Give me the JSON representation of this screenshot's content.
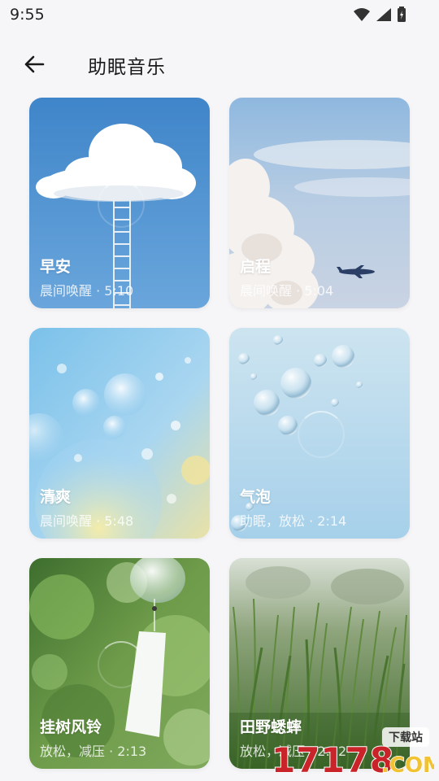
{
  "status": {
    "time": "9:55"
  },
  "header": {
    "title": "助眠音乐"
  },
  "cards": [
    {
      "title": "早安",
      "subtitle": "晨间唤醒 · 5:10"
    },
    {
      "title": "启程",
      "subtitle": "晨间唤醒 · 5:04"
    },
    {
      "title": "清爽",
      "subtitle": "晨间唤醒 · 5:48"
    },
    {
      "title": "气泡",
      "subtitle": "助眠，放松 · 2:14"
    },
    {
      "title": "挂树风铃",
      "subtitle": "放松，减压 · 2:13"
    },
    {
      "title": "田野蟋蟀",
      "subtitle": "放松，减压 · 2:22"
    }
  ],
  "watermark": {
    "brand": "17178.COM",
    "tag": "下载站"
  }
}
